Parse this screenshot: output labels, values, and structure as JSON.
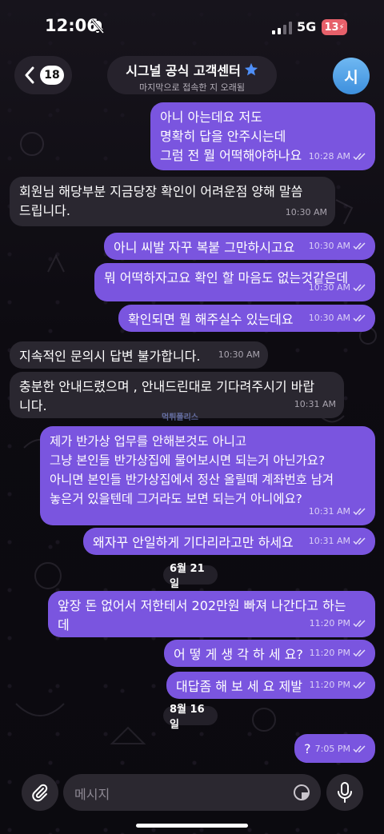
{
  "status_bar": {
    "time": "12:06",
    "network": "5G",
    "battery": "13"
  },
  "header": {
    "back_count": "18",
    "title": "시그널 공식 고객센터",
    "subtitle": "마지막으로 접속한 지 오래됨",
    "avatar_initial": "시"
  },
  "messages": [
    {
      "dir": "out",
      "text": "아니 아는데요 저도\n명확히 답을 안주시는데\n그럼 전 뭘 어떡해야하나요",
      "time": "10:28 AM"
    },
    {
      "dir": "in",
      "text": "회원님 해당부분 지금당장 확인이 어려운점 양해 말씀\n드립니다.",
      "time": "10:30 AM"
    },
    {
      "dir": "out",
      "text": "아니 씨발 자꾸 복붙 그만하시고요",
      "time": "10:30 AM"
    },
    {
      "dir": "out",
      "text": "뭐 어떡하자고요 확인 할 마음도 없는것같은데",
      "time": "10:30 AM"
    },
    {
      "dir": "out",
      "text": "확인되면 뭘 해주실수 있는데요",
      "time": "10:30 AM"
    },
    {
      "dir": "in",
      "text": "지속적인 문의시 답변 불가합니다.",
      "time": "10:30 AM"
    },
    {
      "dir": "in",
      "text": "충분한 안내드렸으며 , 안내드린대로 기다려주시기 바랍\n니다.",
      "time": "10:31 AM"
    },
    {
      "dir": "out",
      "text": "제가 반가상 업무를 안해본것도 아니고\n그냥 본인들 반가상집에 물어보시면 되는거 아닌가요?\n아니면 본인들 반가상집에서 정산 올릴때 계좌번호 남겨\n놓은거 있을텐데 그거라도 보면 되는거 아니에요?",
      "time": "10:31 AM"
    },
    {
      "dir": "out",
      "text": "왜자꾸 안일하게 기다리라고만 하세요",
      "time": "10:31 AM"
    },
    {
      "dir": "out",
      "text": "앞장 돈 없어서 저한테서 202만원 빠져 나간다고 하는\n데",
      "time": "11:20 PM"
    },
    {
      "dir": "out",
      "text": "어 떻 게 생 각 하 세 요?",
      "time": "11:20 PM"
    },
    {
      "dir": "out",
      "text": "대답좀 해 보 세 요 제발",
      "time": "11:20 PM"
    },
    {
      "dir": "out",
      "text": "?",
      "time": "7:05 PM"
    }
  ],
  "dates": [
    "6월 21일",
    "8월 16일"
  ],
  "input": {
    "placeholder": "메시지"
  },
  "watermark": "먹튀폴리스"
}
